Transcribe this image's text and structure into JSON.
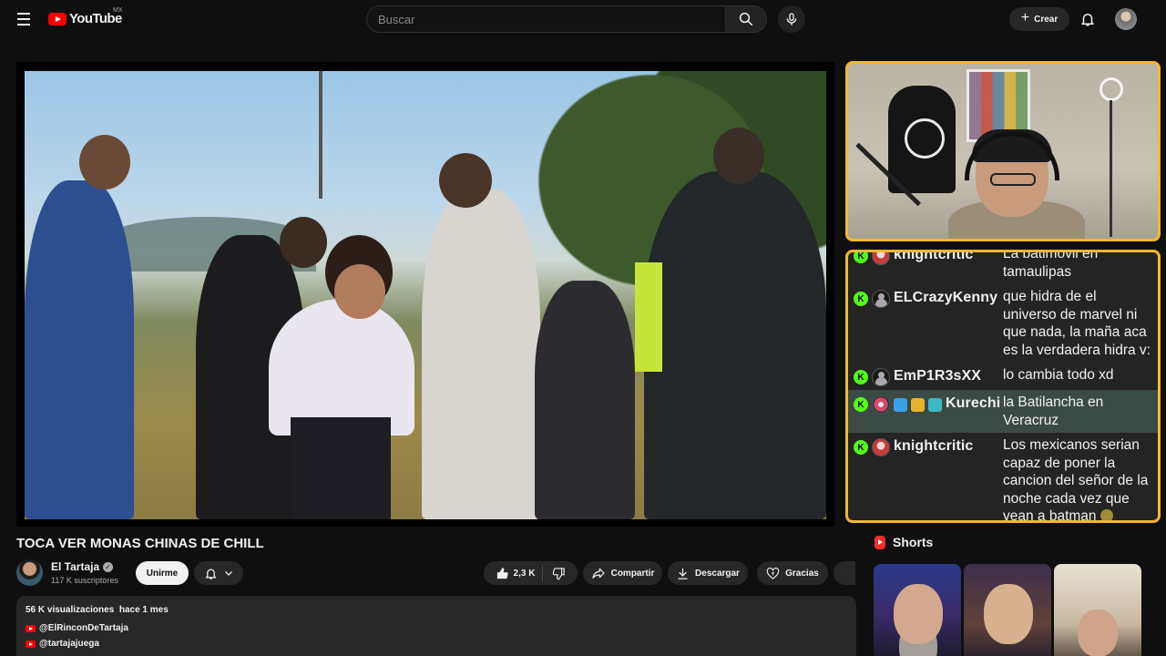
{
  "topbar": {
    "logo_text": "YouTube",
    "country": "MX",
    "search_placeholder": "Buscar",
    "create_label": "Crear",
    "icons": [
      "menu-icon",
      "search-icon",
      "mic-icon",
      "plus-icon",
      "bell-icon"
    ]
  },
  "chat": {
    "messages": [
      {
        "user": "knightcritic",
        "avatar": "red",
        "text": "La batimovil en tamaulipas",
        "highlight": false
      },
      {
        "user": "ELCrazyKenny",
        "avatar": "generic",
        "text": "que hidra de el universo de marvel ni que nada, la maña aca es la verdadera hidra v:",
        "highlight": false
      },
      {
        "user": "EmP1R3sXX",
        "avatar": "generic",
        "text": "lo cambia todo xd",
        "highlight": false
      },
      {
        "user": "Kurechi",
        "avatar": "flower",
        "text": "la Batilancha en Veracruz",
        "highlight": true
      },
      {
        "user": "knightcritic",
        "avatar": "red",
        "text": "Los mexicanos serian capaz de poner la cancion del señor de la noche cada vez que vean a batman",
        "highlight": false
      }
    ],
    "platform_badge": "K"
  },
  "video": {
    "title": "TOCA VER MONAS CHINAS DE CHILL",
    "channel_name": "El Tartaja",
    "subscribers": "117 K suscriptores",
    "join_label": "Unirme",
    "likes": "2,3 K",
    "share_label": "Compartir",
    "download_label": "Descargar",
    "thanks_label": "Gracias"
  },
  "description": {
    "views": "56 K visualizaciones",
    "date": "hace 1 mes",
    "links": [
      "@ElRinconDeTartaja",
      "@tartajajuega"
    ]
  },
  "shorts": {
    "heading": "Shorts"
  },
  "colors": {
    "accent_yellow": "#f5b82e",
    "kick_green": "#53fc18",
    "youtube_red": "#ff0000",
    "background": "#0f0f0f"
  }
}
